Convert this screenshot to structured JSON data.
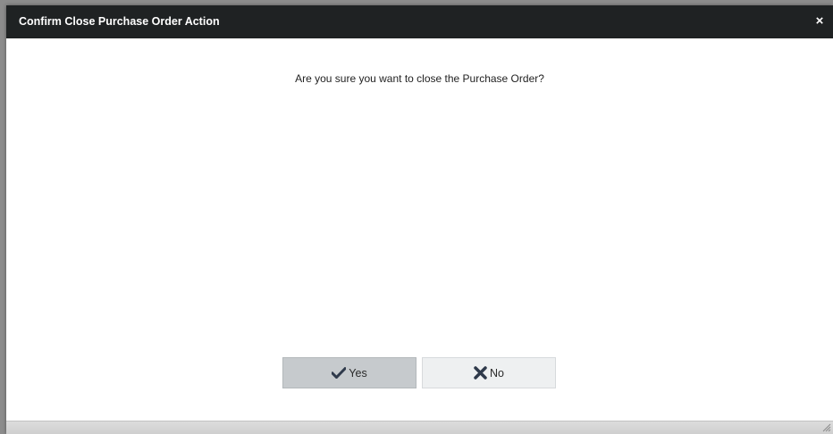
{
  "dialog": {
    "title": "Confirm Close Purchase Order Action",
    "close_glyph": "×",
    "close_icon": "close-icon",
    "message": "Are you sure you want to close the Purchase Order?",
    "yes_button": {
      "label": "Yes",
      "icon": "checkmark-icon"
    },
    "no_button": {
      "label": "No",
      "icon": "x-icon"
    },
    "resize_icon": "resize-grip-icon"
  },
  "colors": {
    "titlebar_bg": "#1f2223",
    "yes_button_bg": "#c6cacd",
    "no_button_bg": "#eef0f1",
    "icon_color": "#2f3a4b"
  }
}
